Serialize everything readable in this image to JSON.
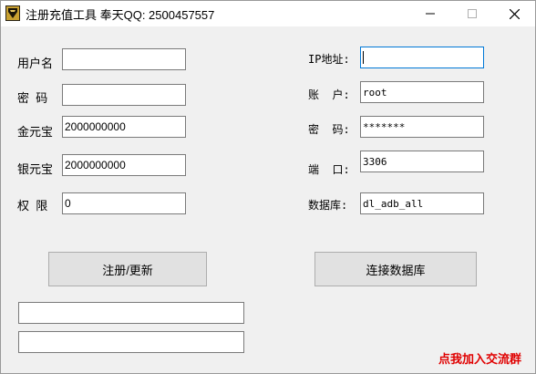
{
  "window": {
    "title": "注册充值工具  奉天QQ: 2500457557"
  },
  "left_form": {
    "username_label": "用户名",
    "username_value": "",
    "password_label": "密  码",
    "password_value": "",
    "gold_label": "金元宝",
    "gold_value": "2000000000",
    "silver_label": "银元宝",
    "silver_value": "2000000000",
    "permission_label": "权  限",
    "permission_value": "0"
  },
  "right_form": {
    "ip_label": "IP地址:",
    "ip_value": "",
    "account_label": "账  户:",
    "account_value": "root",
    "password_label": "密  码:",
    "password_value": "*******",
    "port_label": "端  口:",
    "port_value": "3306",
    "database_label": "数据库:",
    "database_value": "dl_adb_all"
  },
  "buttons": {
    "register_label": "注册/更新",
    "connect_label": "连接数据库"
  },
  "status": {
    "line1": "",
    "line2": ""
  },
  "join_group_link": "点我加入交流群",
  "colors": {
    "link": "#e00000",
    "focus_border": "#0078d7"
  }
}
